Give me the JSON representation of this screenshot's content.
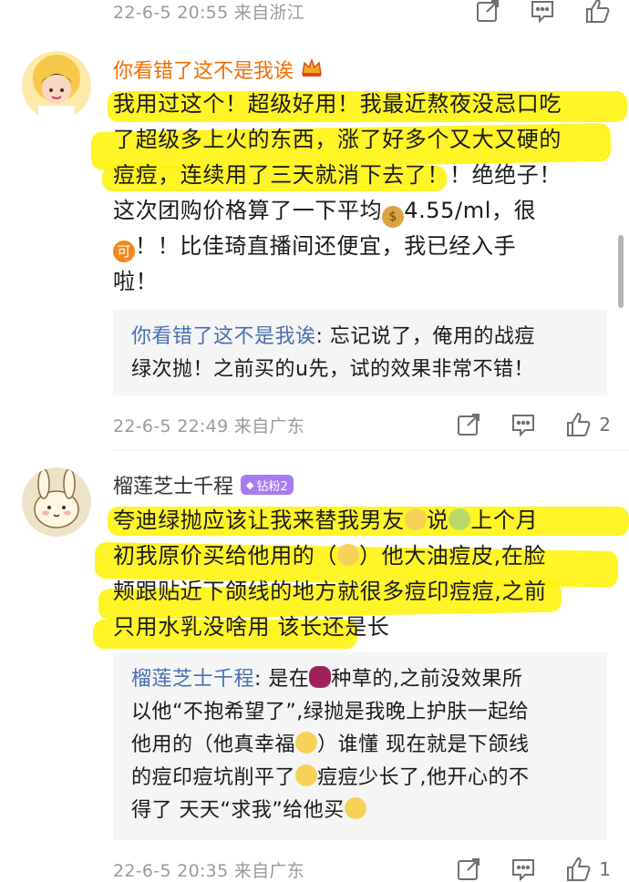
{
  "top_meta": {
    "text": "22-6-5 20:55 来自浙江"
  },
  "comment1": {
    "username": "你看错了这不是我诶",
    "text_lines": [
      "我用过这个！超级好用！我最近熬夜没忌口吃",
      "了超级多上火的东西，涨了好多个又大又硬的",
      "痘痘，连续用了三天就消下去了！！绝绝子！",
      "这次团购价格算了一下平均",
      "4.55/ml，很",
      "！！比佳琦直播间还便宜，我已经入手",
      "啦！"
    ],
    "reply_name": "你看错了这不是我诶",
    "reply_text_1": ": 忘记说了，俺用的战痘",
    "reply_text_2": "绿次抛！之前买的u先，试的效果非常不错！",
    "meta": "22-6-5 22:49 来自广东",
    "like_count": "2"
  },
  "comment2": {
    "username": "榴莲芝士千程",
    "badge": "钻粉2",
    "line1a": "夸迪绿抛应该让我来替我男友",
    "line1b": "说",
    "line1c": "上个月",
    "line2a": "初我原价买给他用的（",
    "line2b": "）他大油痘皮,在脸",
    "line3": "颊跟贴近下颌线的地方就很多痘印痘痘,之前",
    "line4": "只用水乳没啥用 该长还是长",
    "reply_name": "榴莲芝士千程",
    "reply_a": ": 是在",
    "reply_b": "种草的,之前没效果所",
    "reply_2": "以他“不抱希望了”,绿抛是我晚上护肤一起给",
    "reply_3a": "他用的（他真幸福",
    "reply_3b": "）谁懂 现在就是下颌线",
    "reply_4a": "的痘印痘坑削平了",
    "reply_4b": "痘痘少长了,他开心的不",
    "reply_5": "得了 天天“求我”给他买",
    "meta": "22-6-5 20:35 来自广东",
    "like_count": "1"
  },
  "icons": [
    "share-icon",
    "comment-icon",
    "like-icon",
    "crown-icon",
    "money-bag-emoji",
    "ke-emoji"
  ]
}
